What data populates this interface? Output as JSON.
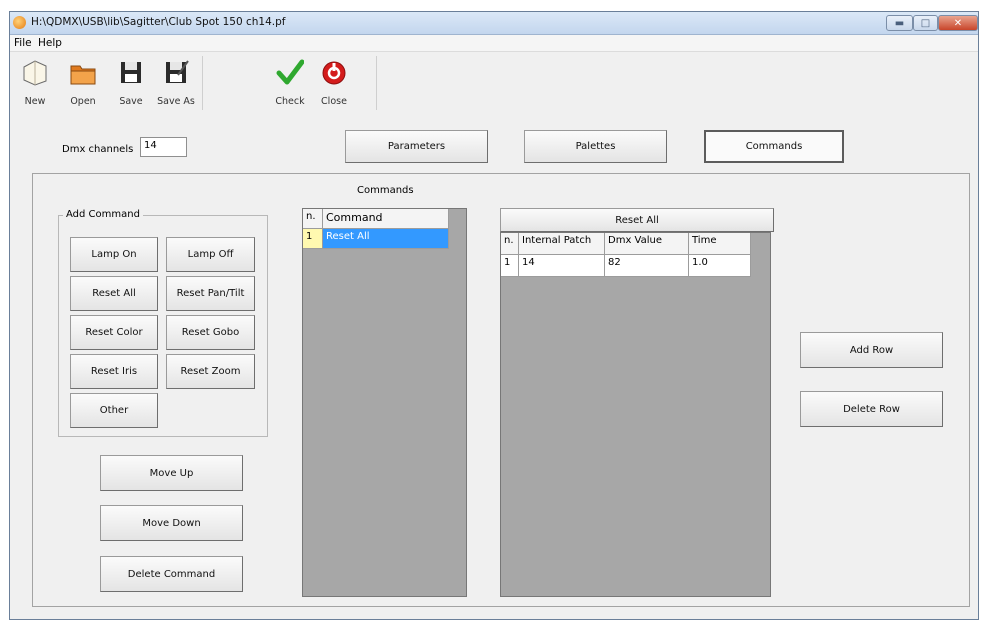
{
  "window": {
    "title": "H:\\QDMX\\USB\\lib\\Sagitter\\Club Spot 150 ch14.pf"
  },
  "menu": {
    "file": "File",
    "help": "Help"
  },
  "toolbar": [
    {
      "label": "New",
      "icon": "new-file-icon"
    },
    {
      "label": "Open",
      "icon": "open-folder-icon"
    },
    {
      "label": "Save",
      "icon": "floppy-save-icon"
    },
    {
      "label": "Save As",
      "icon": "floppy-save-as-icon"
    },
    {
      "label": "Check",
      "icon": "check-icon"
    },
    {
      "label": "Close",
      "icon": "close-power-icon"
    }
  ],
  "dmx_channels": {
    "label": "Dmx channels",
    "value": "14"
  },
  "tabs": [
    {
      "label": "Parameters",
      "active": false
    },
    {
      "label": "Palettes",
      "active": false
    },
    {
      "label": "Commands",
      "active": true
    }
  ],
  "add_command": {
    "title": "Add Command",
    "buttons": [
      "Lamp On",
      "Lamp Off",
      "Reset All",
      "Reset Pan/Tilt",
      "Reset Color",
      "Reset Gobo",
      "Reset Iris",
      "Reset Zoom",
      "Other"
    ]
  },
  "command_actions": {
    "move_up": "Move Up",
    "move_down": "Move Down",
    "delete": "Delete Command"
  },
  "commands_list": {
    "title": "Commands",
    "columns": [
      "n.",
      "Command"
    ],
    "rows": [
      {
        "n": "1",
        "command": "Reset All",
        "selected": true
      }
    ]
  },
  "detail": {
    "header": "Reset All",
    "columns": [
      "n.",
      "Internal Patch",
      "Dmx Value",
      "Time"
    ],
    "rows": [
      {
        "n": "1",
        "internal_patch": "14",
        "dmx_value": "82",
        "time": "1.0"
      }
    ]
  },
  "row_actions": {
    "add": "Add Row",
    "delete": "Delete Row"
  },
  "colors": {
    "selection": "#3399ff",
    "grid_bg": "#a7a7a7",
    "titlebar": "#c3d6ee"
  }
}
